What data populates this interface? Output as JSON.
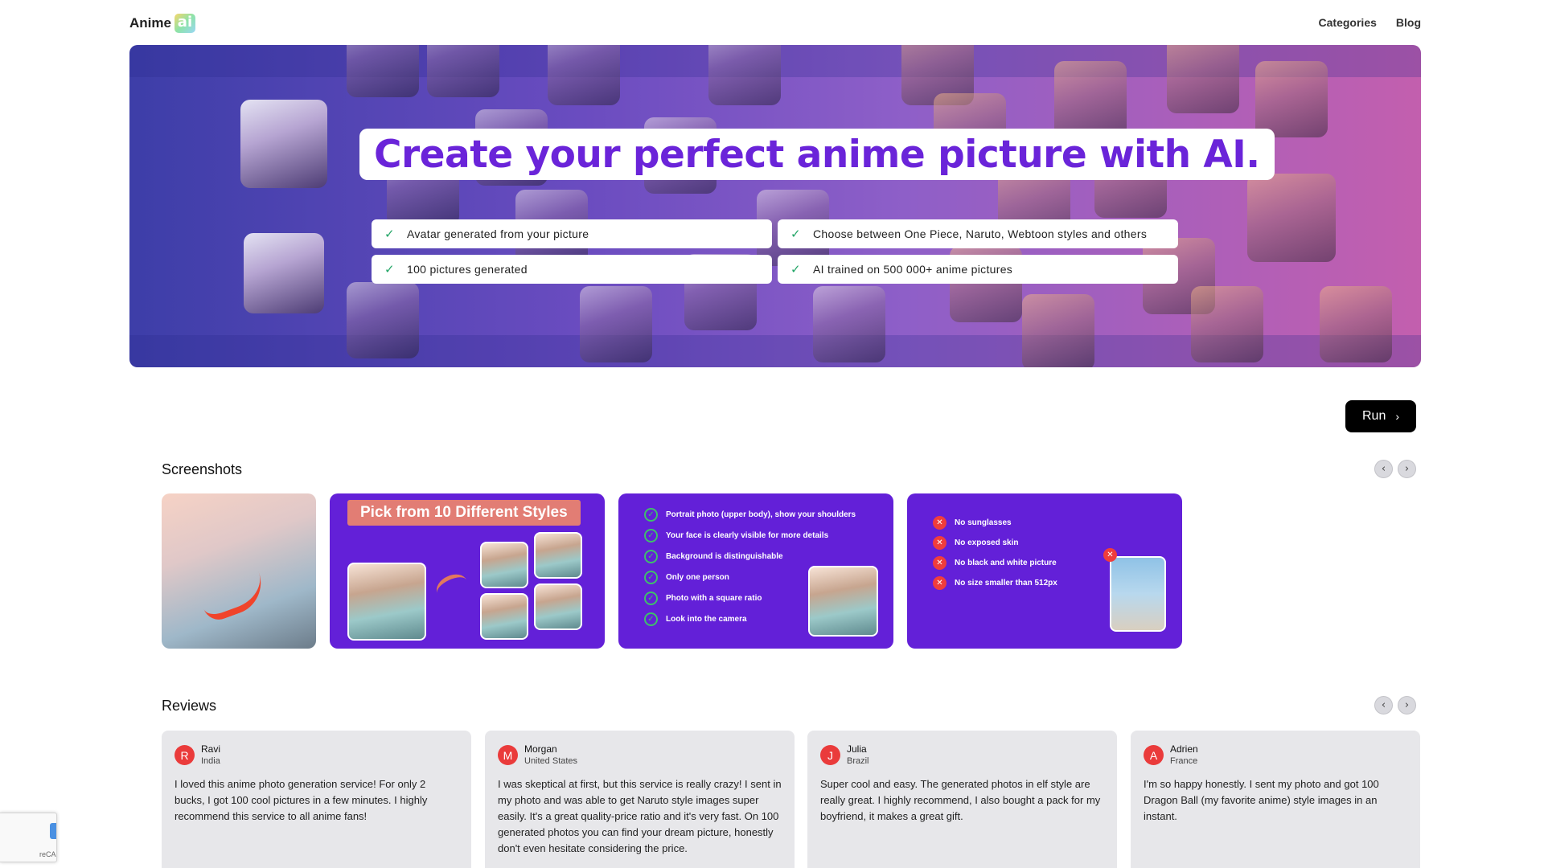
{
  "header": {
    "logo_text": "Anime",
    "logo_badge": "ai",
    "nav": [
      {
        "label": "Categories"
      },
      {
        "label": "Blog"
      }
    ]
  },
  "hero": {
    "title": "Create your perfect anime picture with AI.",
    "features": [
      {
        "text": "Avatar generated from your picture"
      },
      {
        "text": "Choose between One Piece, Naruto, Webtoon styles and others"
      },
      {
        "text": "100 pictures generated"
      },
      {
        "text": "AI trained on 500 000+ anime pictures"
      }
    ]
  },
  "run_label": "Run",
  "screenshots": {
    "title": "Screenshots",
    "styles_heading": "Pick from 10 Different Styles",
    "do_rules": [
      "Portrait photo (upper body), show your shoulders",
      "Your face is clearly visible for more details",
      "Background is distinguishable",
      "Only one person",
      "Photo with a square ratio",
      "Look into the camera"
    ],
    "dont_rules": [
      "No sunglasses",
      "No exposed skin",
      "No black and white picture",
      "No size smaller than 512px"
    ]
  },
  "reviews": {
    "title": "Reviews",
    "items": [
      {
        "initial": "R",
        "name": "Ravi",
        "country": "India",
        "text": "I loved this anime photo generation service! For only 2 bucks, I got 100 cool pictures in a few minutes. I highly recommend this service to all anime fans!"
      },
      {
        "initial": "M",
        "name": "Morgan",
        "country": "United States",
        "text": "I was skeptical at first, but this service is really crazy! I sent in my photo and was able to get Naruto style images super easily. It's a great quality-price ratio and it's very fast. On 100 generated photos you can find your dream picture, honestly don't even hesitate considering the price."
      },
      {
        "initial": "J",
        "name": "Julia",
        "country": "Brazil",
        "text": "Super cool and easy. The generated photos in elf style are really great. I highly recommend, I also bought a pack for my boyfriend, it makes a great gift."
      },
      {
        "initial": "A",
        "name": "Adrien",
        "country": "France",
        "text": "I'm so happy honestly. I sent my photo and got 100 Dragon Ball (my favorite anime) style images in an instant."
      }
    ]
  },
  "recaptcha_text": "reCA",
  "colors": {
    "accent_purple": "#6a24d9",
    "card_purple": "#6320d8",
    "check_green": "#22a566",
    "avatar_red": "#ea3b3b"
  },
  "icons": [
    "check-icon",
    "chevron-right-icon",
    "chevron-left-icon",
    "x-circle-icon"
  ]
}
